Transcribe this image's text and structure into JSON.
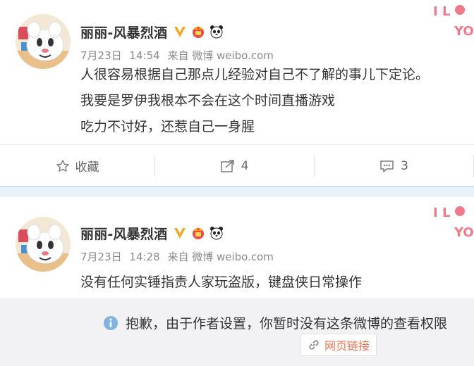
{
  "posts": [
    {
      "username": "丽丽-风暴烈酒",
      "date": "7月23日",
      "time": "14:54",
      "source": "来自 微博 weibo.com",
      "lines": [
        "人很容易根据自己那点儿经验对自己不了解的事儿下定论。",
        "我要是罗伊我根本不会在这个时间直播游戏",
        "吃力不讨好，还惹自己一身腥"
      ],
      "actions": {
        "favorite": "收藏",
        "repost_count": "4",
        "comment_count": "3"
      }
    },
    {
      "username": "丽丽-风暴烈酒",
      "date": "7月23日",
      "time": "14:28",
      "source": "来自 微博 weibo.com",
      "lines": [
        "没有任何实锤指责人家玩盗版，键盘侠日常操作"
      ],
      "notice": "抱歉，由于作者设置，你暂时没有这条微博的查看权限",
      "link_label": "网页链接"
    }
  ],
  "decoration_text": "I LOVE YOU",
  "colors": {
    "accent": "#eb7350",
    "verified": "#f5a623",
    "separator": "#eaf2f9",
    "notice_bg": "#f2f2f5"
  },
  "icons": [
    "verified-v-icon",
    "crown-badge-icon",
    "panda-icon",
    "star-icon",
    "share-icon",
    "comment-icon",
    "info-icon",
    "link-icon"
  ]
}
